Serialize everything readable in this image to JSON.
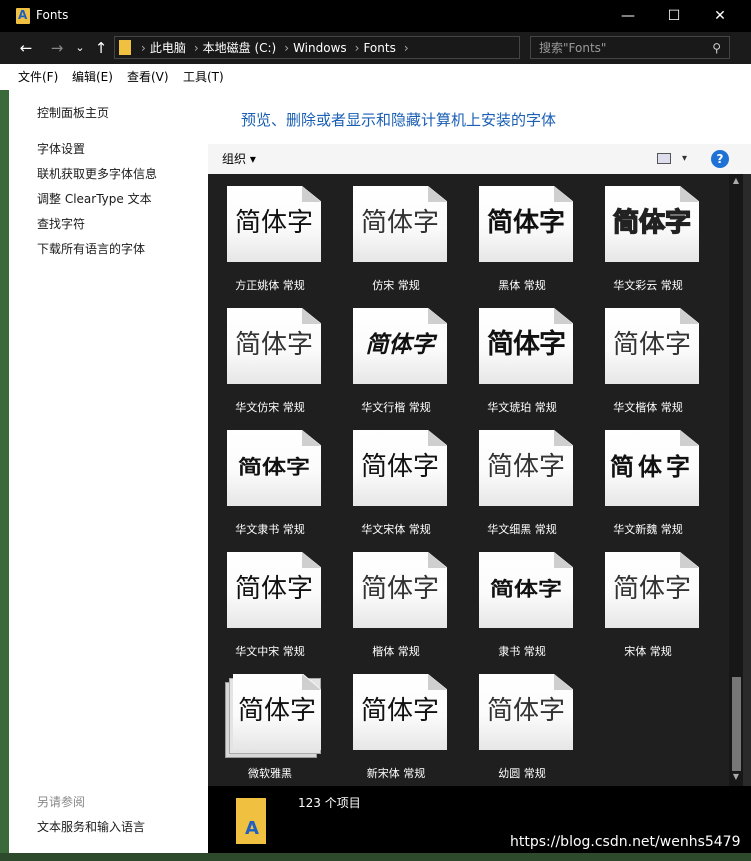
{
  "window": {
    "title": "Fonts",
    "controls": {
      "minimize": "—",
      "maximize": "☐",
      "close": "✕"
    }
  },
  "nav": {
    "back": "←",
    "forward": "→",
    "recent": "⌄",
    "up": "↑"
  },
  "address": {
    "crumbs": [
      "此电脑",
      "本地磁盘 (C:)",
      "Windows",
      "Fonts"
    ],
    "separator": "›",
    "dropdown": "⌄",
    "refresh": "↻"
  },
  "search": {
    "placeholder": "搜索\"Fonts\""
  },
  "menu": [
    "文件(F)",
    "编辑(E)",
    "查看(V)",
    "工具(T)"
  ],
  "sidebar": {
    "home": "控制面板主页",
    "links": [
      "字体设置",
      "联机获取更多字体信息",
      "调整 ClearType 文本",
      "查找字符",
      "下载所有语言的字体"
    ],
    "see_also": "另请参阅",
    "see_also_link": "文本服务和输入语言"
  },
  "header": {
    "title": "预览、删除或者显示和隐藏计算机上安装的字体"
  },
  "toolbar": {
    "organize": "组织 ▾",
    "view_dropdown": "▾",
    "help": "?"
  },
  "fonts": [
    {
      "sample": "简体字",
      "label": "方正姚体 常规"
    },
    {
      "sample": "简体字",
      "label": "仿宋 常规"
    },
    {
      "sample": "简体字",
      "label": "黑体 常规"
    },
    {
      "sample": "简体字",
      "label": "华文彩云 常规"
    },
    {
      "sample": "简体字",
      "label": "华文仿宋 常规"
    },
    {
      "sample": "简体字",
      "label": "华文行楷 常规"
    },
    {
      "sample": "简体字",
      "label": "华文琥珀 常规"
    },
    {
      "sample": "简体字",
      "label": "华文楷体 常规"
    },
    {
      "sample": "简体字",
      "label": "华文隶书 常规"
    },
    {
      "sample": "简体字",
      "label": "华文宋体 常规"
    },
    {
      "sample": "简体字",
      "label": "华文细黑 常规"
    },
    {
      "sample": "简体字",
      "label": "华文新魏 常规"
    },
    {
      "sample": "简体字",
      "label": "华文中宋 常规"
    },
    {
      "sample": "简体字",
      "label": "楷体 常规"
    },
    {
      "sample": "简体字",
      "label": "隶书 常规"
    },
    {
      "sample": "简体字",
      "label": "宋体 常规"
    },
    {
      "sample": "简体字",
      "label": "微软雅黑"
    },
    {
      "sample": "简体字",
      "label": "新宋体 常规"
    },
    {
      "sample": "简体字",
      "label": "幼圆 常规"
    }
  ],
  "status": {
    "count": "123 个项目"
  },
  "watermark": "https://blog.csdn.net/wenhs5479",
  "colors": {
    "accent": "#1a5fb4",
    "content_bg": "#1f1f1f",
    "titlebar": "#000000",
    "folder": "#f0c040"
  }
}
